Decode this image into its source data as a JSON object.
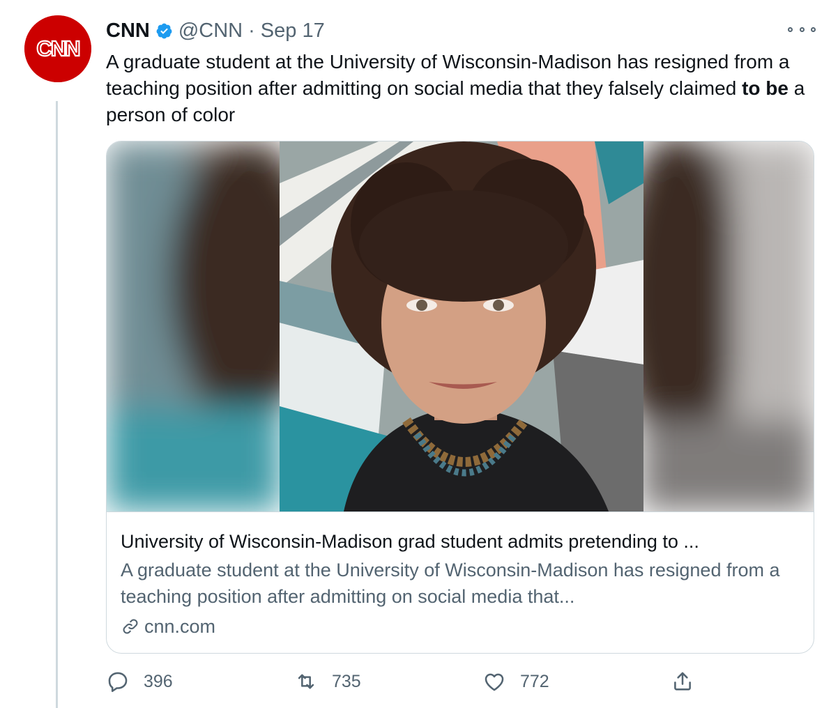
{
  "tweet": {
    "author_name": "CNN",
    "handle": "@CNN",
    "separator": "·",
    "date": "Sep 17",
    "text_before": "A graduate student at the University of Wisconsin-Madison has resigned from a teaching position after admitting on social media that they falsely claimed ",
    "text_bold": "to be",
    "text_after": " a person of color",
    "avatar_text": "CNN"
  },
  "card": {
    "title": "University of Wisconsin-Madison grad student admits pretending to ...",
    "description": "A graduate student at the University of Wisconsin-Madison has resigned from a teaching position after admitting on social media that...",
    "domain": "cnn.com"
  },
  "actions": {
    "replies": "396",
    "retweets": "735",
    "likes": "772"
  },
  "colors": {
    "verified": "#1d9bf0",
    "cnn_red": "#cc0000",
    "secondary_text": "#536471"
  }
}
